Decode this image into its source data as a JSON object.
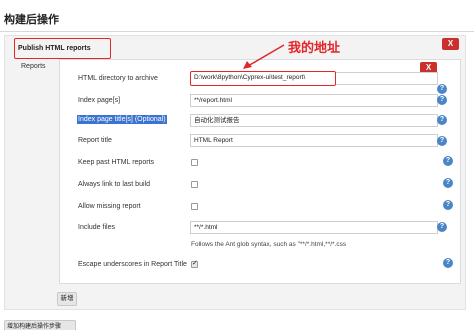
{
  "section_title": "构建后操作",
  "post_build_action": {
    "title": "Publish HTML reports",
    "delete_label": "X"
  },
  "reports_label": "Reports",
  "report_entry": {
    "delete_label": "X",
    "fields": {
      "html_directory": {
        "label": "HTML directory to archive",
        "value": "D:\\work\\8python\\Cyprex-ui\\test_report\\"
      },
      "index_pages": {
        "label": "Index page[s]",
        "value": "**/report.html"
      },
      "index_titles": {
        "label": "Index page title[s] (Optional)",
        "value": "自动化测试报告"
      },
      "report_title": {
        "label": "Report title",
        "value": "HTML Report"
      },
      "keep_past": {
        "label": "Keep past HTML reports",
        "checked": false
      },
      "always_link": {
        "label": "Always link to last build",
        "checked": false
      },
      "allow_missing": {
        "label": "Allow missing report",
        "checked": false
      },
      "include_files": {
        "label": "Include files",
        "value": "**/*.html",
        "hint": "Follows the Ant glob syntax, such as \"**/*.html,**/*.css"
      },
      "escape_underscores": {
        "label": "Escape underscores in Report Title",
        "checked": true
      }
    },
    "help_glyph": "?"
  },
  "add_button_label": "新增",
  "bottom_button_label": "增加构建后操作步骤",
  "annotation_text": "我的地址",
  "colors": {
    "accent_red": "#e3262a",
    "help_blue": "#4a86c7",
    "selection_blue": "#3b73d1",
    "delete_red": "#c9302c"
  }
}
